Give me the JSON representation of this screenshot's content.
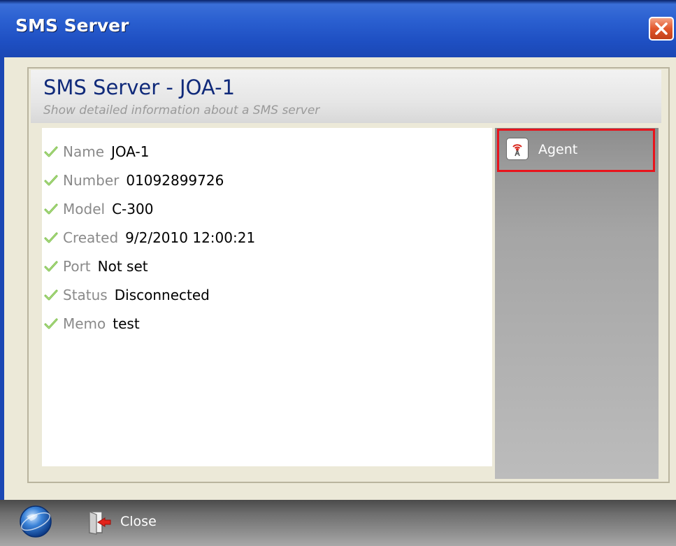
{
  "window": {
    "title": "SMS Server"
  },
  "panel": {
    "title": "SMS Server - JOA-1",
    "subtitle": "Show detailed information about a SMS server"
  },
  "fields": [
    {
      "label": "Name",
      "value": "JOA-1"
    },
    {
      "label": "Number",
      "value": "01092899726"
    },
    {
      "label": "Model",
      "value": "C-300"
    },
    {
      "label": "Created",
      "value": "9/2/2010 12:00:21"
    },
    {
      "label": "Port",
      "value": "Not set"
    },
    {
      "label": "Status",
      "value": "Disconnected"
    },
    {
      "label": "Memo",
      "value": "test"
    }
  ],
  "sidebar": {
    "items": [
      {
        "label": "Agent",
        "icon": "antenna-icon",
        "highlighted": true
      }
    ]
  },
  "bottombar": {
    "close_label": "Close"
  },
  "icons": {
    "field_marker": "check-icon",
    "window_close": "close-icon",
    "app": "globe-icon",
    "close_action": "exit-door-icon"
  },
  "colors": {
    "title_bar": "#2a5fd0",
    "highlight_border": "#e8141c",
    "panel_title": "#102a7a",
    "check": "#7cbf4a"
  }
}
